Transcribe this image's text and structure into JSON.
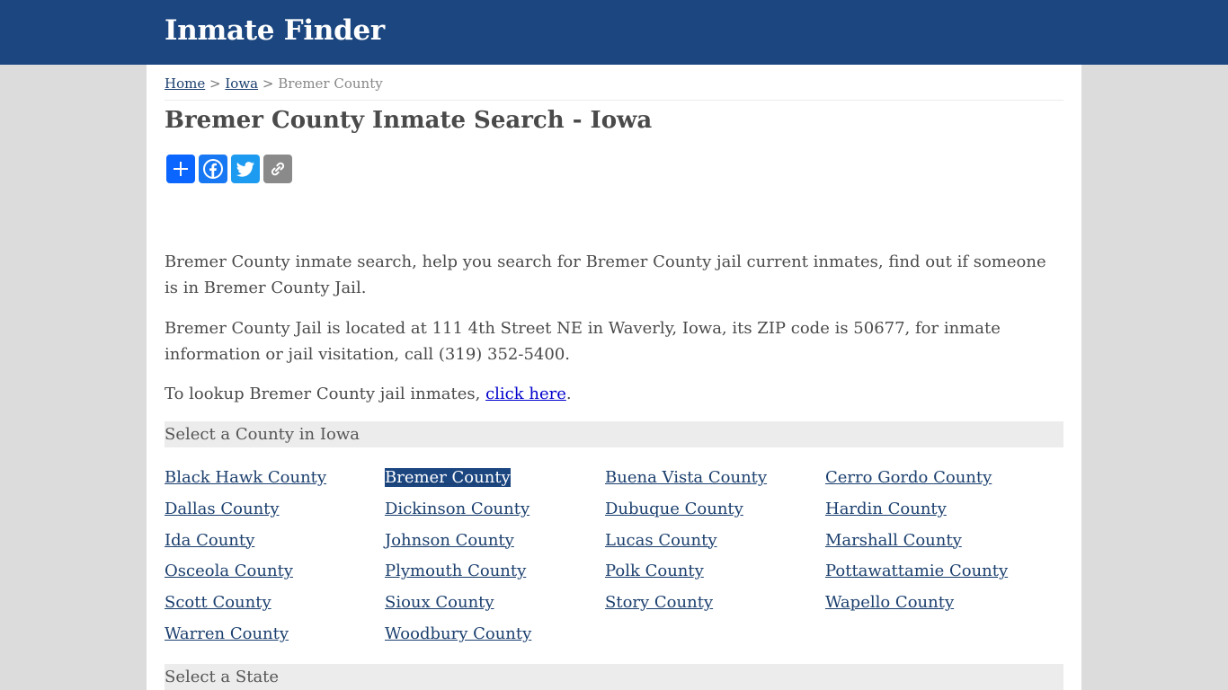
{
  "header": {
    "site_title": "Inmate Finder",
    "bg_color": "#1b4680"
  },
  "breadcrumb": {
    "home": "Home",
    "sep1": ">",
    "state": "Iowa",
    "sep2": ">",
    "current": "Bremer County"
  },
  "page_title": "Bremer County Inmate Search - Iowa",
  "share": {
    "icons": [
      "add-share-icon",
      "facebook-icon",
      "twitter-icon",
      "copy-link-icon"
    ]
  },
  "content": {
    "p1": "Bremer County inmate search, help you search for Bremer County jail current inmates, find out if someone is in Bremer County Jail.",
    "p2": "Bremer County Jail is located at 111 4th Street NE in Waverly, Iowa, its ZIP code is 50677, for inmate information or jail visitation, call (319) 352-5400.",
    "p3_prefix": "To lookup Bremer County jail inmates, ",
    "p3_link": "click here",
    "p3_suffix": "."
  },
  "county_section": {
    "title": "Select a County in Iowa",
    "selected": "Bremer County",
    "counties": [
      "Black Hawk County",
      "Bremer County",
      "Buena Vista County",
      "Cerro Gordo County",
      "Dallas County",
      "Dickinson County",
      "Dubuque County",
      "Hardin County",
      "Ida County",
      "Johnson County",
      "Lucas County",
      "Marshall County",
      "Osceola County",
      "Plymouth County",
      "Polk County",
      "Pottawattamie County",
      "Scott County",
      "Sioux County",
      "Story County",
      "Wapello County",
      "Warren County",
      "Woodbury County"
    ]
  },
  "state_section": {
    "title": "Select a State"
  }
}
